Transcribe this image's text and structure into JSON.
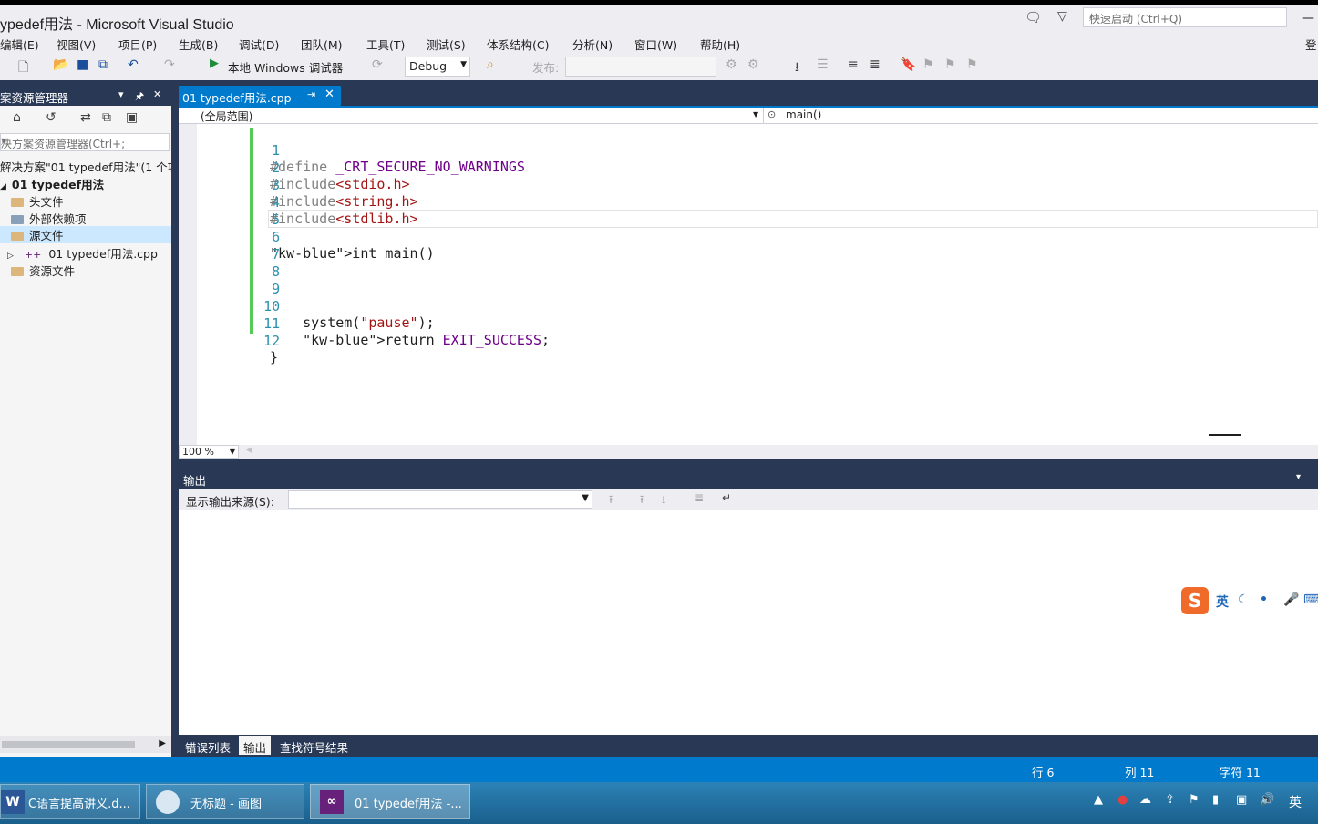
{
  "window": {
    "title": "ypedef用法 - Microsoft Visual Studio",
    "quick_launch_placeholder": "快速启动 (Ctrl+Q)",
    "login_text": "登"
  },
  "menu": [
    "编辑(E)",
    "视图(V)",
    "项目(P)",
    "生成(B)",
    "调试(D)",
    "团队(M)",
    "工具(T)",
    "测试(S)",
    "体系结构(C)",
    "分析(N)",
    "窗口(W)",
    "帮助(H)"
  ],
  "toolbar": {
    "run_label": "本地 Windows 调试器",
    "config": "Debug",
    "publish_label": "发布:"
  },
  "solution_explorer": {
    "title": "案资源管理器",
    "search_placeholder": "决方案资源管理器(Ctrl+;",
    "tree": [
      {
        "label": "解决方案\"01 typedef用法\"(1 个项",
        "kind": "solution"
      },
      {
        "label": "01 typedef用法",
        "kind": "project"
      },
      {
        "label": "头文件",
        "kind": "folder"
      },
      {
        "label": "外部依赖项",
        "kind": "folder"
      },
      {
        "label": "源文件",
        "kind": "folder",
        "selected": true
      },
      {
        "label": "01 typedef用法.cpp",
        "kind": "file"
      },
      {
        "label": "资源文件",
        "kind": "folder"
      }
    ]
  },
  "editor": {
    "tab_label": "01 typedef用法.cpp",
    "scope": "(全局范围)",
    "member": "main()",
    "zoom": "100 %",
    "lines": [
      {
        "n": "1",
        "text": "#define _CRT_SECURE_NO_WARNINGS"
      },
      {
        "n": "2",
        "text": "#include<stdio.h>"
      },
      {
        "n": "3",
        "text": "#include<string.h>"
      },
      {
        "n": "4",
        "text": "#include<stdlib.h>"
      },
      {
        "n": "5",
        "text": ""
      },
      {
        "n": "6",
        "text": "int main()"
      },
      {
        "n": "7",
        "text": ""
      },
      {
        "n": "8",
        "text": ""
      },
      {
        "n": "9",
        "text": ""
      },
      {
        "n": "10",
        "text": "    system(\"pause\");"
      },
      {
        "n": "11",
        "text": "    return EXIT_SUCCESS;"
      },
      {
        "n": "12",
        "text": "}"
      }
    ]
  },
  "output": {
    "title": "输出",
    "source_label": "显示输出来源(S):",
    "source_value": ""
  },
  "bottom_tabs": [
    "错误列表",
    "输出",
    "查找符号结果"
  ],
  "status": {
    "line": "行 6",
    "col": "列 11",
    "char": "字符 11"
  },
  "taskbar": {
    "items": [
      "C语言提高讲义.d...",
      "无标题 - 画图",
      "01 typedef用法 -..."
    ],
    "ime": "英"
  },
  "ime_bar": {
    "mode": "英"
  },
  "colors": {
    "accent": "#007acc",
    "dark_chrome": "#293955",
    "background": "#eeeef2"
  }
}
